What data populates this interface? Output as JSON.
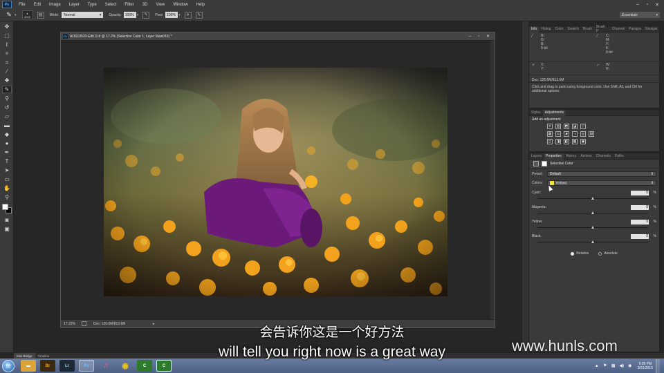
{
  "menubar": {
    "app_logo": "Ps",
    "items": [
      "File",
      "Edit",
      "Image",
      "Layer",
      "Type",
      "Select",
      "Filter",
      "3D",
      "View",
      "Window",
      "Help"
    ]
  },
  "options_bar": {
    "brush_size": "4000",
    "mode_label": "Mode:",
    "mode_value": "Normal",
    "opacity_label": "Opacity:",
    "opacity_value": "100%",
    "flow_label": "Flow:",
    "flow_value": "100%",
    "workspace": "Essentials"
  },
  "tools": [
    "move",
    "marquee",
    "lasso",
    "quick-select",
    "crop",
    "eyedropper",
    "spot-heal",
    "brush",
    "clone-stamp",
    "history-brush",
    "eraser",
    "gradient",
    "blur",
    "dodge",
    "pen",
    "type",
    "path-select",
    "shape",
    "hand",
    "zoom"
  ],
  "document": {
    "title": "AOS19520-Edit 2.tif @ 17.2% (Selective Color 1, Layer Mask/16) *",
    "zoom": "17.22%",
    "doc_info": "Doc: 126.6M/813.6M"
  },
  "info_panel": {
    "tabs": [
      "Info",
      "Histog",
      "Color",
      "Swatch",
      "Brush",
      "Brush P",
      "Channel",
      "Paragra",
      "Navigat"
    ],
    "left_channels": [
      "R:",
      "G:",
      "B:"
    ],
    "left_mode": "8-bit",
    "right_channels": [
      "C:",
      "M:",
      "Y:",
      "K:"
    ],
    "right_mode": "8-bit",
    "xy": [
      "X:",
      "Y:"
    ],
    "wh": [
      "W:",
      "H:"
    ],
    "doc_size": "Doc: 126.6M/813.6M",
    "hint": "Click and drag to paint using foreground color. Use Shift, Alt, and Ctrl for additional options."
  },
  "adjustments_panel": {
    "tabs": [
      "Styles",
      "Adjustments"
    ],
    "heading": "Add an adjustment",
    "row1": [
      "☀",
      "▥",
      "◩",
      "◪",
      "▽"
    ],
    "row2": [
      "▦",
      "⚖",
      "■",
      "◑",
      "◎",
      "▤"
    ],
    "row3": [
      "◫",
      "◨",
      "◧",
      "▩",
      "▣"
    ]
  },
  "properties_panel": {
    "tabs": [
      "Layers",
      "Properties",
      "History",
      "Actions",
      "Channels",
      "Paths"
    ],
    "title": "Selective Color",
    "preset_label": "Preset:",
    "preset_value": "Default",
    "colors_label": "Colors:",
    "colors_value": "Yellows",
    "sliders": [
      {
        "name": "Cyan:",
        "value": "0",
        "unit": "%",
        "level": 0
      },
      {
        "name": "Magenta:",
        "value": "0",
        "unit": "%",
        "level": 0
      },
      {
        "name": "Yellow:",
        "value": "0",
        "unit": "%",
        "level": 0
      },
      {
        "name": "Black:",
        "value": "0",
        "unit": "%",
        "level": 0
      }
    ],
    "method_relative": "Relative",
    "method_absolute": "Absolute",
    "method_selected": "Relative"
  },
  "bottom_tabs": [
    "Mini Bridge",
    "Timeline"
  ],
  "taskbar": {
    "apps": [
      "Explorer",
      "Br",
      "Lr",
      "Ps",
      "iTunes",
      "Chrome",
      "Camtasia",
      "Camtasia Recorder"
    ],
    "active_app": "Ps",
    "time": "5:26 PM",
    "date": "3/31/2015"
  },
  "subtitle": {
    "chinese": "会告诉你这是一个好方法",
    "english": "will tell you right now is a great way"
  },
  "watermark": "www.hunls.com",
  "colors": {
    "dress": "#6b1a7a",
    "flowers": "#f2a21c",
    "ui_bg": "#3a3a3a",
    "swatch_chip": "#f1e33a"
  }
}
